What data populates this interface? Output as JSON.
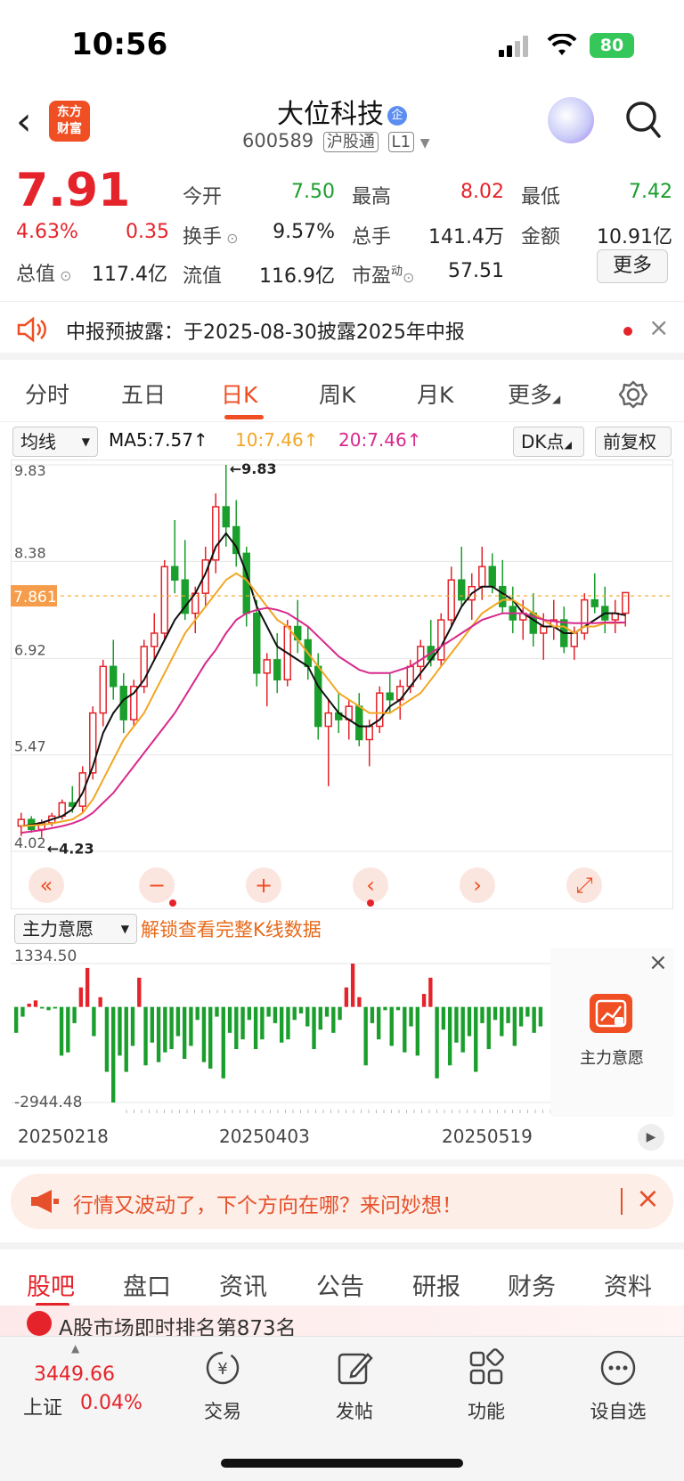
{
  "status": {
    "time": "10:56",
    "battery": "80"
  },
  "header": {
    "back_icon": "chevron-left-icon",
    "logo": "东方\n财富",
    "title": "大位科技",
    "title_badge": "企",
    "code": "600589",
    "market_tag": "沪股通",
    "level_tag": "L1"
  },
  "quote": {
    "price": "7.91",
    "change_pct": "4.63%",
    "change_amt": "0.35",
    "open_label": "今开",
    "open": "7.50",
    "high_label": "最高",
    "high": "8.02",
    "low_label": "最低",
    "low": "7.42",
    "turnover_label": "换手",
    "turnover": "9.57%",
    "volume_label": "总手",
    "volume": "141.4万",
    "amount_label": "金额",
    "amount": "10.91亿",
    "mktcap_label": "总值",
    "mktcap": "117.4亿",
    "float_label": "流值",
    "float": "116.9亿",
    "pe_label": "市盈",
    "pe_sup": "动",
    "pe": "57.51",
    "more": "更多"
  },
  "notice": {
    "text": "中报预披露：于2025-08-30披露2025年中报"
  },
  "chart_tabs": [
    "分时",
    "五日",
    "日K",
    "周K",
    "月K",
    "更多"
  ],
  "active_chart_tab": "日K",
  "ma_row": {
    "selector": "均线",
    "ma5": "MA5:7.57↑",
    "ma10": "10:7.46↑",
    "ma20": "20:7.46↑",
    "dk": "DK点",
    "adjust": "前复权"
  },
  "chart_data": {
    "type": "candlestick",
    "y_ticks": [
      "9.83",
      "8.38",
      "6.92",
      "5.47",
      "4.02"
    ],
    "ylim": [
      4.02,
      9.83
    ],
    "current_price_label": "7.861",
    "annotations": [
      "←9.83",
      "←4.23"
    ],
    "ohlc": [
      [
        4.4,
        4.6,
        4.25,
        4.5
      ],
      [
        4.5,
        4.55,
        4.3,
        4.35
      ],
      [
        4.35,
        4.5,
        4.23,
        4.45
      ],
      [
        4.45,
        4.6,
        4.4,
        4.55
      ],
      [
        4.55,
        4.8,
        4.5,
        4.75
      ],
      [
        4.75,
        5.0,
        4.6,
        4.7
      ],
      [
        4.7,
        5.3,
        4.6,
        5.2
      ],
      [
        5.2,
        6.2,
        5.1,
        6.1
      ],
      [
        6.1,
        6.9,
        5.9,
        6.8
      ],
      [
        6.8,
        7.2,
        6.3,
        6.5
      ],
      [
        6.5,
        6.7,
        5.8,
        6.0
      ],
      [
        6.0,
        6.6,
        5.9,
        6.5
      ],
      [
        6.5,
        7.2,
        6.4,
        7.1
      ],
      [
        7.1,
        7.6,
        6.9,
        7.3
      ],
      [
        7.3,
        8.4,
        7.2,
        8.3
      ],
      [
        8.3,
        9.0,
        7.9,
        8.1
      ],
      [
        8.1,
        8.7,
        7.5,
        7.6
      ],
      [
        7.6,
        8.0,
        7.3,
        7.9
      ],
      [
        7.9,
        8.6,
        7.7,
        8.4
      ],
      [
        8.4,
        9.4,
        8.2,
        9.2
      ],
      [
        9.2,
        9.83,
        8.6,
        8.9
      ],
      [
        8.9,
        9.3,
        8.3,
        8.5
      ],
      [
        8.5,
        8.6,
        7.4,
        7.6
      ],
      [
        7.6,
        7.8,
        6.5,
        6.7
      ],
      [
        6.7,
        7.0,
        6.2,
        6.9
      ],
      [
        6.9,
        7.3,
        6.4,
        6.6
      ],
      [
        6.6,
        7.5,
        6.5,
        7.4
      ],
      [
        7.4,
        7.8,
        7.0,
        7.2
      ],
      [
        7.2,
        7.4,
        6.6,
        6.8
      ],
      [
        6.8,
        7.0,
        5.7,
        5.9
      ],
      [
        5.9,
        6.3,
        5.0,
        6.1
      ],
      [
        6.1,
        6.4,
        5.8,
        6.0
      ],
      [
        6.0,
        6.3,
        5.7,
        6.2
      ],
      [
        6.2,
        6.4,
        5.6,
        5.7
      ],
      [
        5.7,
        6.0,
        5.3,
        5.9
      ],
      [
        5.9,
        6.5,
        5.8,
        6.4
      ],
      [
        6.4,
        6.7,
        6.1,
        6.3
      ],
      [
        6.3,
        6.6,
        6.0,
        6.5
      ],
      [
        6.5,
        6.9,
        6.4,
        6.8
      ],
      [
        6.8,
        7.2,
        6.6,
        7.1
      ],
      [
        7.1,
        7.5,
        6.8,
        6.9
      ],
      [
        6.9,
        7.6,
        6.8,
        7.5
      ],
      [
        7.5,
        8.3,
        7.4,
        8.1
      ],
      [
        8.1,
        8.6,
        7.7,
        7.8
      ],
      [
        7.8,
        8.2,
        7.5,
        8.0
      ],
      [
        8.0,
        8.6,
        7.8,
        8.3
      ],
      [
        8.3,
        8.5,
        7.9,
        8.0
      ],
      [
        8.0,
        8.4,
        7.6,
        7.7
      ],
      [
        7.7,
        8.0,
        7.3,
        7.5
      ],
      [
        7.5,
        7.8,
        7.2,
        7.6
      ],
      [
        7.6,
        7.9,
        7.1,
        7.3
      ],
      [
        7.3,
        7.6,
        6.9,
        7.4
      ],
      [
        7.4,
        7.8,
        7.2,
        7.5
      ],
      [
        7.5,
        7.7,
        7.0,
        7.1
      ],
      [
        7.1,
        7.4,
        6.9,
        7.3
      ],
      [
        7.3,
        7.9,
        7.2,
        7.8
      ],
      [
        7.8,
        8.2,
        7.6,
        7.7
      ],
      [
        7.7,
        8.0,
        7.3,
        7.5
      ],
      [
        7.5,
        7.8,
        7.3,
        7.6
      ],
      [
        7.6,
        7.9,
        7.4,
        7.91
      ]
    ],
    "ma5": [
      4.4,
      4.42,
      4.45,
      4.5,
      4.55,
      4.65,
      4.9,
      5.3,
      5.8,
      6.1,
      6.3,
      6.4,
      6.6,
      6.9,
      7.2,
      7.5,
      7.7,
      7.9,
      8.2,
      8.6,
      8.8,
      8.6,
      8.2,
      7.7,
      7.4,
      7.1,
      7.0,
      6.9,
      6.8,
      6.5,
      6.3,
      6.1,
      6.0,
      5.9,
      5.9,
      6.0,
      6.2,
      6.3,
      6.5,
      6.7,
      6.9,
      7.1,
      7.4,
      7.7,
      7.9,
      8.0,
      8.0,
      7.9,
      7.8,
      7.6,
      7.5,
      7.4,
      7.4,
      7.3,
      7.3,
      7.4,
      7.5,
      7.6,
      7.6,
      7.57
    ],
    "ma10": [
      4.4,
      4.41,
      4.42,
      4.44,
      4.47,
      4.5,
      4.6,
      4.8,
      5.1,
      5.4,
      5.7,
      5.9,
      6.1,
      6.4,
      6.7,
      7.0,
      7.3,
      7.5,
      7.7,
      7.9,
      8.1,
      8.2,
      8.1,
      7.9,
      7.7,
      7.5,
      7.4,
      7.2,
      7.0,
      6.8,
      6.6,
      6.4,
      6.3,
      6.2,
      6.1,
      6.1,
      6.1,
      6.2,
      6.3,
      6.4,
      6.6,
      6.8,
      7.0,
      7.2,
      7.4,
      7.6,
      7.7,
      7.8,
      7.8,
      7.7,
      7.6,
      7.5,
      7.4,
      7.4,
      7.3,
      7.4,
      7.4,
      7.45,
      7.45,
      7.46
    ],
    "ma20": [
      4.3,
      4.32,
      4.34,
      4.37,
      4.4,
      4.44,
      4.5,
      4.6,
      4.75,
      4.9,
      5.1,
      5.3,
      5.5,
      5.7,
      5.9,
      6.1,
      6.35,
      6.6,
      6.85,
      7.05,
      7.3,
      7.5,
      7.6,
      7.65,
      7.68,
      7.65,
      7.6,
      7.5,
      7.4,
      7.25,
      7.1,
      6.95,
      6.85,
      6.75,
      6.7,
      6.7,
      6.7,
      6.75,
      6.8,
      6.9,
      7.0,
      7.1,
      7.2,
      7.3,
      7.4,
      7.5,
      7.55,
      7.6,
      7.6,
      7.6,
      7.55,
      7.5,
      7.48,
      7.46,
      7.45,
      7.45,
      7.45,
      7.46,
      7.46,
      7.46
    ],
    "controls": [
      "rewind-icon",
      "zoom-out-icon",
      "zoom-in-icon",
      "prev-icon",
      "next-icon",
      "fullscreen-icon"
    ]
  },
  "sub_indicator": {
    "selector": "主力意愿",
    "unlock": "解锁查看完整K线数据",
    "ymax": "1334.50",
    "ymin": "-2944.48",
    "panel_label": "主力意愿",
    "values": [
      -800,
      -300,
      100,
      200,
      -50,
      -100,
      -50,
      -1500,
      -1400,
      -500,
      600,
      1200,
      -900,
      300,
      -2000,
      -2944,
      -1500,
      -2000,
      -1200,
      900,
      -1800,
      -1100,
      -1700,
      -1400,
      -1300,
      -900,
      -1600,
      -1200,
      -400,
      -1700,
      -1900,
      -300,
      -2200,
      -800,
      -1300,
      -1000,
      -400,
      -1300,
      -1000,
      -300,
      -500,
      -1100,
      -1000,
      -400,
      -200,
      -600,
      -1300,
      -700,
      -300,
      -800,
      -400,
      600,
      1334,
      300,
      -1800,
      -500,
      -1000,
      -100,
      -1200,
      -100,
      -1400,
      -600,
      -1500,
      400,
      900,
      -2200,
      -700,
      -1800,
      -1100,
      -1400,
      -900,
      -2000,
      -500,
      -1300,
      -400,
      -900,
      -500,
      -1200,
      -600,
      -300,
      -800,
      -600
    ]
  },
  "dates": [
    "20250218",
    "20250403",
    "20250519"
  ],
  "banner": {
    "text": "行情又波动了，下个方向在哪？来问妙想！"
  },
  "bottom_tabs": [
    "股吧",
    "盘口",
    "资讯",
    "公告",
    "研报",
    "财务",
    "资料"
  ],
  "peek": {
    "text": "A股市场即时排名第873名"
  },
  "bottom_bar": {
    "index_value": "3449.66",
    "index_name": "上证",
    "index_change": "0.04%",
    "items": [
      "交易",
      "发帖",
      "功能",
      "设自选"
    ]
  },
  "colors": {
    "up": "#e5232a",
    "down": "#1a9e2c",
    "accent": "#f04e23",
    "ma5": "#111111",
    "ma10": "#f2a623",
    "ma20": "#d8288c"
  }
}
